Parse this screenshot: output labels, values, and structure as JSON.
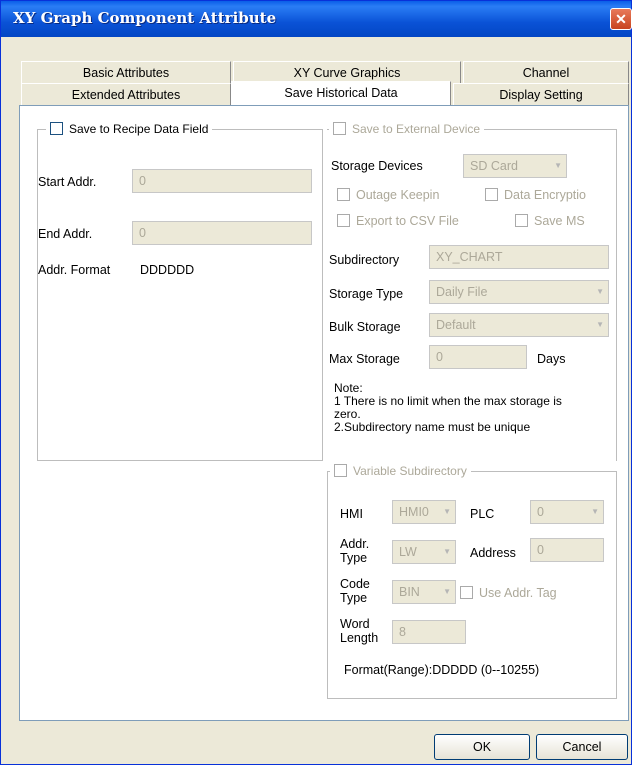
{
  "window": {
    "title": "XY Graph Component Attribute",
    "close_symbol": "✕"
  },
  "tabs_row1": [
    {
      "label": "Basic Attributes"
    },
    {
      "label": "XY Curve Graphics"
    },
    {
      "label": "Channel"
    }
  ],
  "tabs_row2": [
    {
      "label": "Extended Attributes"
    },
    {
      "label": "Save Historical Data"
    },
    {
      "label": "Display Setting"
    }
  ],
  "recipe": {
    "checkbox_label": "Save to Recipe Data Field",
    "start_addr_label": "Start Addr.",
    "start_addr_value": "0",
    "end_addr_label": "End Addr.",
    "end_addr_value": "0",
    "addr_format_label": "Addr. Format",
    "addr_format_value": "DDDDDD"
  },
  "external": {
    "checkbox_label": "Save to External Device",
    "storage_devices_label": "Storage Devices",
    "storage_devices_value": "SD Card",
    "outage_keepin_label": "Outage Keepin",
    "data_encryption_label": "Data Encryptio",
    "export_csv_label": "Export to CSV File",
    "save_ms_label": "Save MS",
    "subdirectory_label": "Subdirectory",
    "subdirectory_value": "XY_CHART",
    "storage_type_label": "Storage Type",
    "storage_type_value": "Daily File",
    "bulk_storage_label": "Bulk Storage",
    "bulk_storage_value": "Default",
    "max_storage_label": "Max Storage",
    "max_storage_value": "0",
    "days_label": "Days",
    "note_lines": [
      "Note:",
      "1 There is no limit when the max storage is",
      "zero.",
      "2.Subdirectory name must be unique"
    ]
  },
  "variable": {
    "checkbox_label": "Variable Subdirectory",
    "hmi_label": "HMI",
    "hmi_value": "HMI0",
    "plc_label": "PLC",
    "plc_value": "0",
    "addr_type_label_1": "Addr.",
    "addr_type_label_2": "Type",
    "addr_type_value": "LW",
    "address_label": "Address",
    "address_value": "0",
    "code_type_label_1": "Code",
    "code_type_label_2": "Type",
    "code_type_value": "BIN",
    "use_addr_tag_label": "Use Addr. Tag",
    "word_length_label_1": "Word",
    "word_length_label_2": "Length",
    "word_length_value": "8",
    "format_range": "Format(Range):DDDDD (0--10255)"
  },
  "buttons": {
    "ok": "OK",
    "cancel": "Cancel"
  }
}
